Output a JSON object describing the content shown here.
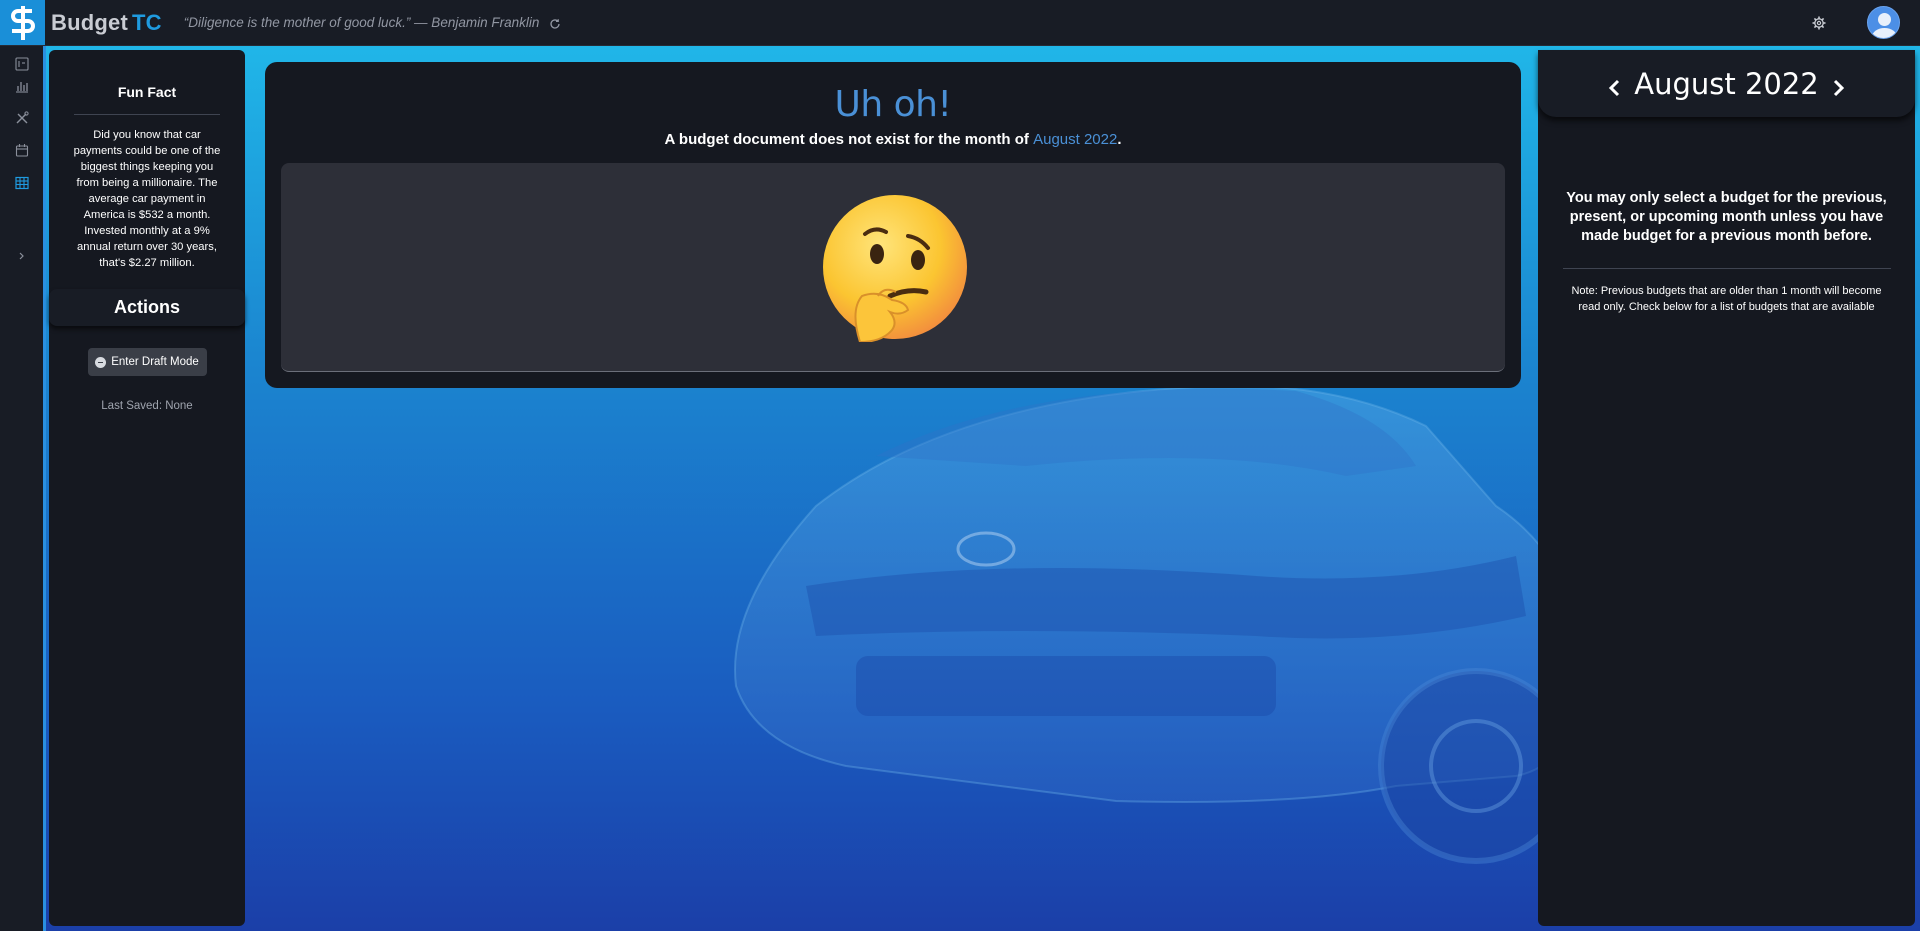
{
  "app": {
    "brand_prefix": "Budget",
    "brand_suffix": "TC",
    "quote": "“Diligence is the mother of good luck.” — Benjamin Franklin"
  },
  "rail": {
    "icons": [
      "dashboard-icon",
      "bar-chart-icon",
      "tools-icon",
      "calendar-icon",
      "table-icon",
      "expand-chevron-icon"
    ]
  },
  "fun_fact": {
    "title": "Fun Fact",
    "text": "Did you know that car payments could be one of the biggest things keeping you from being a millionaire. The average car payment in America is $532 a month. Invested monthly at a 9% annual return over 30 years, that's $2.27 million."
  },
  "actions": {
    "title": "Actions",
    "draft_button": "Enter Draft Mode",
    "last_saved": "Last Saved: None"
  },
  "main": {
    "heading": "Uh oh!",
    "message_prefix": "A budget document does not exist for the month of ",
    "message_month": "August 2022",
    "message_suffix": "."
  },
  "month_panel": {
    "month": "August 2022",
    "select_message": "You may only select a budget for the previous, present, or upcoming month unless you have made budget for a previous month before.",
    "note": "Note: Previous budgets that are older than 1 month will become read only. Check below for a list of budgets that are available"
  },
  "colors": {
    "accent": "#1f9be0",
    "link": "#4a90d6",
    "panel": "#151820"
  }
}
